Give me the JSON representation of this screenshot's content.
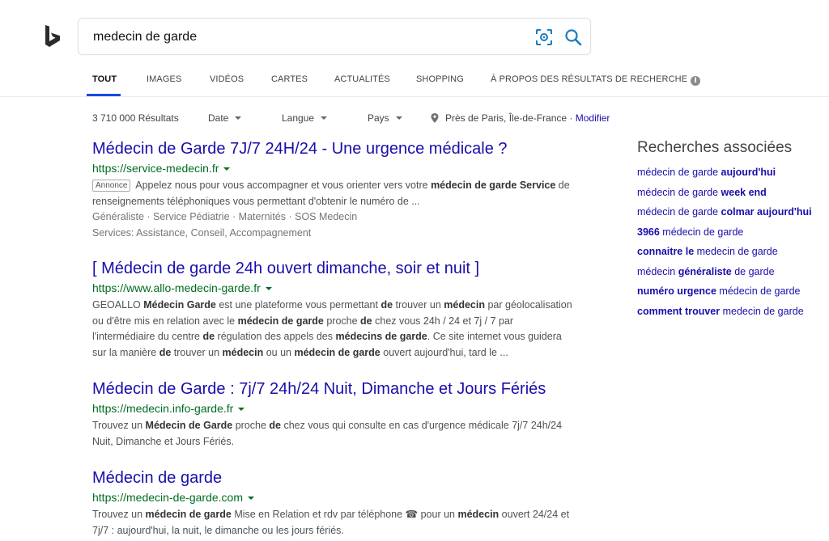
{
  "search": {
    "query": "medecin de garde",
    "visual_search_icon": "visual-search-icon",
    "search_icon": "magnifier-icon"
  },
  "brand": {
    "logo": "bing-logo",
    "color": "#2b2b2b"
  },
  "tabs": [
    {
      "label": "TOUT",
      "active": true
    },
    {
      "label": "IMAGES"
    },
    {
      "label": "VIDÉOS"
    },
    {
      "label": "CARTES"
    },
    {
      "label": "ACTUALITÉS"
    },
    {
      "label": "SHOPPING"
    },
    {
      "label": "À PROPOS DES RÉSULTATS DE RECHERCHE",
      "icon": "info-icon"
    }
  ],
  "filters": {
    "count": "3 710 000 Résultats",
    "date": "Date",
    "langue": "Langue",
    "pays": "Pays",
    "location": "Près de Paris, Île-de-France",
    "separator": "·",
    "modify": "Modifier"
  },
  "results": [
    {
      "title": "Médecin de Garde 7J/7 24H/24 - Une urgence médicale ?",
      "url": "https://service-medecin.fr",
      "ad_badge": "Annonce",
      "snippet": [
        {
          "t": " Appelez nous pour vous accompagner et vous orienter vers votre "
        },
        {
          "t": "médecin de garde",
          "b": true
        },
        {
          "t": " "
        },
        {
          "t": "Service",
          "b": true
        },
        {
          "t": " de renseignements téléphoniques vous permettant d'obtenir le numéro de ..."
        }
      ],
      "sitelinks": [
        "Généraliste",
        "Service Pédiatrie",
        "Maternités",
        "SOS Medecin"
      ],
      "services": "Services: Assistance, Conseil, Accompagnement"
    },
    {
      "title": "[ Médecin de garde 24h ouvert dimanche, soir et nuit ]",
      "url": "https://www.allo-medecin-garde.fr",
      "snippet": [
        {
          "t": "GEOALLO "
        },
        {
          "t": "Médecin Garde",
          "b": true
        },
        {
          "t": " est une plateforme vous permettant "
        },
        {
          "t": "de",
          "b": true
        },
        {
          "t": " trouver un "
        },
        {
          "t": "médecin",
          "b": true
        },
        {
          "t": " par géolocalisation ou d'être mis en relation avec le "
        },
        {
          "t": "médecin de garde",
          "b": true
        },
        {
          "t": " proche "
        },
        {
          "t": "de",
          "b": true
        },
        {
          "t": " chez vous 24h / 24 et 7j / 7 par l'intermédiaire du centre "
        },
        {
          "t": "de",
          "b": true
        },
        {
          "t": " régulation des appels des "
        },
        {
          "t": "médecins de garde",
          "b": true
        },
        {
          "t": ". Ce site internet vous guidera sur la manière "
        },
        {
          "t": "de",
          "b": true
        },
        {
          "t": " trouver un "
        },
        {
          "t": "médecin",
          "b": true
        },
        {
          "t": " ou un "
        },
        {
          "t": "médecin de garde",
          "b": true
        },
        {
          "t": " ouvert aujourd'hui, tard le ..."
        }
      ]
    },
    {
      "title": "Médecin de Garde : 7j/7 24h/24 Nuit, Dimanche et Jours Fériés",
      "url": "https://medecin.info-garde.fr",
      "snippet": [
        {
          "t": "Trouvez un "
        },
        {
          "t": "Médecin de Garde",
          "b": true
        },
        {
          "t": " proche "
        },
        {
          "t": "de",
          "b": true
        },
        {
          "t": " chez vous qui consulte en cas d'urgence médicale 7j/7 24h/24 Nuit, Dimanche et Jours Fériés."
        }
      ]
    },
    {
      "title": "Médecin de garde",
      "url": "https://medecin-de-garde.com",
      "snippet": [
        {
          "t": "Trouvez un "
        },
        {
          "t": "médecin de garde",
          "b": true
        },
        {
          "t": " Mise en Relation et rdv par téléphone ☎ pour un "
        },
        {
          "t": "médecin",
          "b": true
        },
        {
          "t": " ouvert 24/24 et 7j/7 : aujourd'hui, la nuit, le dimanche ou les jours fériés."
        }
      ]
    }
  ],
  "related": {
    "title": "Recherches associées",
    "items": [
      [
        {
          "t": "médecin de garde "
        },
        {
          "t": "aujourd'hui",
          "b": true
        }
      ],
      [
        {
          "t": "médecin de garde "
        },
        {
          "t": "week end",
          "b": true
        }
      ],
      [
        {
          "t": "médecin de garde "
        },
        {
          "t": "colmar aujourd'hui",
          "b": true
        }
      ],
      [
        {
          "t": "3966",
          "b": true
        },
        {
          "t": " médecin de garde"
        }
      ],
      [
        {
          "t": "connaitre le",
          "b": true
        },
        {
          "t": " medecin de garde"
        }
      ],
      [
        {
          "t": "médecin "
        },
        {
          "t": "généraliste",
          "b": true
        },
        {
          "t": " de garde"
        }
      ],
      [
        {
          "t": "numéro urgence",
          "b": true
        },
        {
          "t": " médecin de garde"
        }
      ],
      [
        {
          "t": "comment trouver",
          "b": true
        },
        {
          "t": " medecin de garde"
        }
      ]
    ]
  },
  "colors": {
    "link": "#1a0dab",
    "url": "#006d21",
    "tab_active_underline": "#174ae4",
    "accent_icon": "#1d7bbd"
  }
}
